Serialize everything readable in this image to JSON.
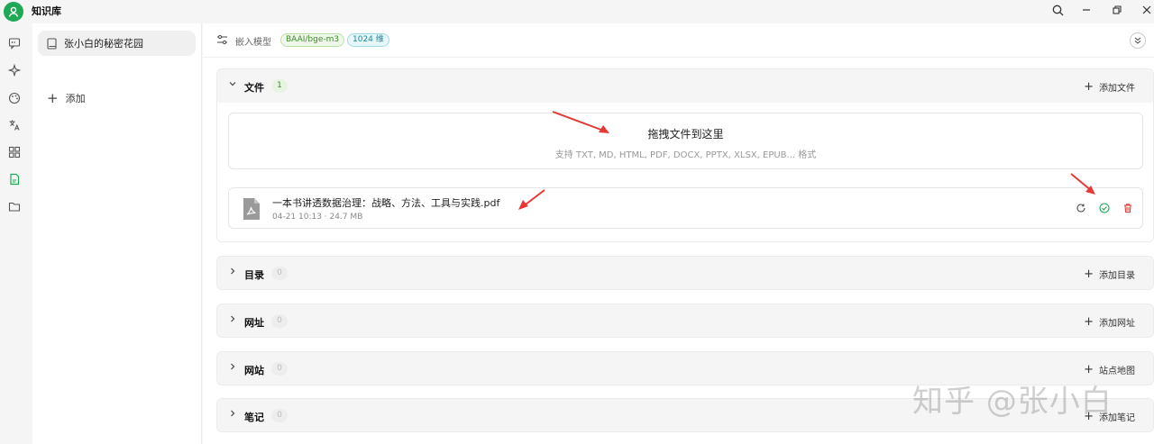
{
  "app": {
    "title": "知识库"
  },
  "window": {
    "controls": [
      "search-icon",
      "minimize-icon",
      "restore-icon",
      "close-icon"
    ]
  },
  "rail": {
    "items": [
      {
        "icon": "chat-icon"
      },
      {
        "icon": "sparkle-icon"
      },
      {
        "icon": "palette-icon"
      },
      {
        "icon": "translate-icon"
      },
      {
        "icon": "grid-icon"
      },
      {
        "icon": "knowledge-icon",
        "active": true
      },
      {
        "icon": "folder-icon"
      }
    ]
  },
  "kb_list": {
    "items": [
      {
        "name": "张小白的秘密花园"
      }
    ],
    "add_label": "添加"
  },
  "toolbar": {
    "embed_label": "嵌入模型",
    "model_tag": "BAAI/bge-m3",
    "dim_tag": "1024 维"
  },
  "sections": {
    "files": {
      "title": "文件",
      "count": "1",
      "action": "添加文件",
      "dropzone": {
        "title": "拖拽文件到这里",
        "subtitle": "支持 TXT, MD, HTML, PDF, DOCX, PPTX, XLSX, EPUB... 格式"
      },
      "items": [
        {
          "name": "一本书讲透数据治理：战略、方法、工具与实践.pdf",
          "meta": "04-21 10:13 · 24.7 MB"
        }
      ]
    },
    "directories": {
      "title": "目录",
      "count": "0",
      "action": "添加目录"
    },
    "urls": {
      "title": "网址",
      "count": "0",
      "action": "添加网址"
    },
    "sites": {
      "title": "网站",
      "count": "0",
      "action": "站点地图"
    },
    "notes": {
      "title": "笔记",
      "count": "0",
      "action": "添加笔记"
    }
  },
  "colors": {
    "accent": "#1fa855",
    "danger": "#e53935",
    "arrow": "#e53935"
  },
  "watermark": "知乎 @张小白"
}
